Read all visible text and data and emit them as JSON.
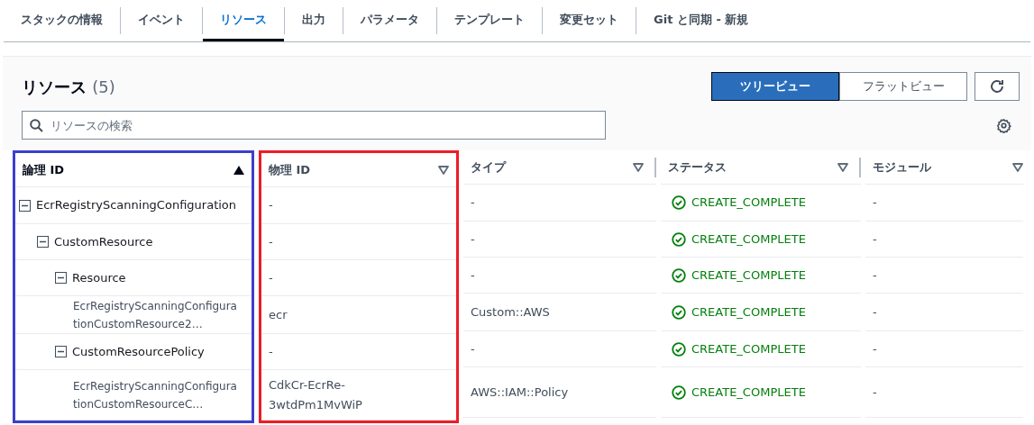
{
  "tabs": [
    {
      "label": "スタックの情報",
      "selected": false
    },
    {
      "label": "イベント",
      "selected": false
    },
    {
      "label": "リソース",
      "selected": true
    },
    {
      "label": "出力",
      "selected": false
    },
    {
      "label": "パラメータ",
      "selected": false
    },
    {
      "label": "テンプレート",
      "selected": false
    },
    {
      "label": "変更セット",
      "selected": false
    },
    {
      "label": "Git と同期 - 新規",
      "selected": false
    }
  ],
  "panel": {
    "title": "リソース",
    "count": "(5)",
    "view_toggle": [
      {
        "label": "ツリービュー",
        "selected": true
      },
      {
        "label": "フラットビュー",
        "selected": false
      }
    ],
    "search": {
      "placeholder": "リソースの検索"
    }
  },
  "table": {
    "columns": [
      {
        "label": "論理 ID",
        "sorted": true,
        "color": "#3b3fcc"
      },
      {
        "label": "物理 ID",
        "sorted": false,
        "color": "#ee1c25"
      },
      {
        "label": "タイプ",
        "sorted": false
      },
      {
        "label": "ステータス",
        "sorted": false
      },
      {
        "label": "モジュール",
        "sorted": false
      }
    ],
    "rows": [
      {
        "logical_id": "EcrRegistryScanningConfiguration",
        "expanded": true,
        "physical_id": "-",
        "type": "-",
        "status": {
          "kind": "success",
          "label": "CREATE_COMPLETE"
        },
        "module": "-",
        "children": [
          {
            "logical_id": "CustomResource",
            "expanded": true,
            "physical_id": "-",
            "type": "-",
            "status": {
              "kind": "success",
              "label": "CREATE_COMPLETE"
            },
            "module": "-",
            "children": [
              {
                "logical_id": "Resource",
                "expanded": true,
                "physical_id": "-",
                "type": "-",
                "status": {
                  "kind": "success",
                  "label": "CREATE_COMPLETE"
                },
                "module": "-",
                "children": [
                  {
                    "logical_id": "EcrRegistryScanningConfigurationCustomResource2…",
                    "physical_id": "ecr",
                    "type": "Custom::AWS",
                    "status": {
                      "kind": "success",
                      "label": "CREATE_COMPLETE"
                    },
                    "module": "-"
                  }
                ]
              },
              {
                "logical_id": "CustomResourcePolicy",
                "expanded": true,
                "physical_id": "-",
                "type": "-",
                "status": {
                  "kind": "success",
                  "label": "CREATE_COMPLETE"
                },
                "module": "-",
                "children": [
                  {
                    "logical_id": "EcrRegistryScanningConfigurationCustomResourceC…",
                    "physical_id": "CdkCr-EcrRe-3wtdPm1MvWiP",
                    "type": "AWS::IAM::Policy",
                    "status": {
                      "kind": "success",
                      "label": "CREATE_COMPLETE"
                    },
                    "module": "-"
                  }
                ]
              }
            ]
          }
        ]
      }
    ]
  }
}
